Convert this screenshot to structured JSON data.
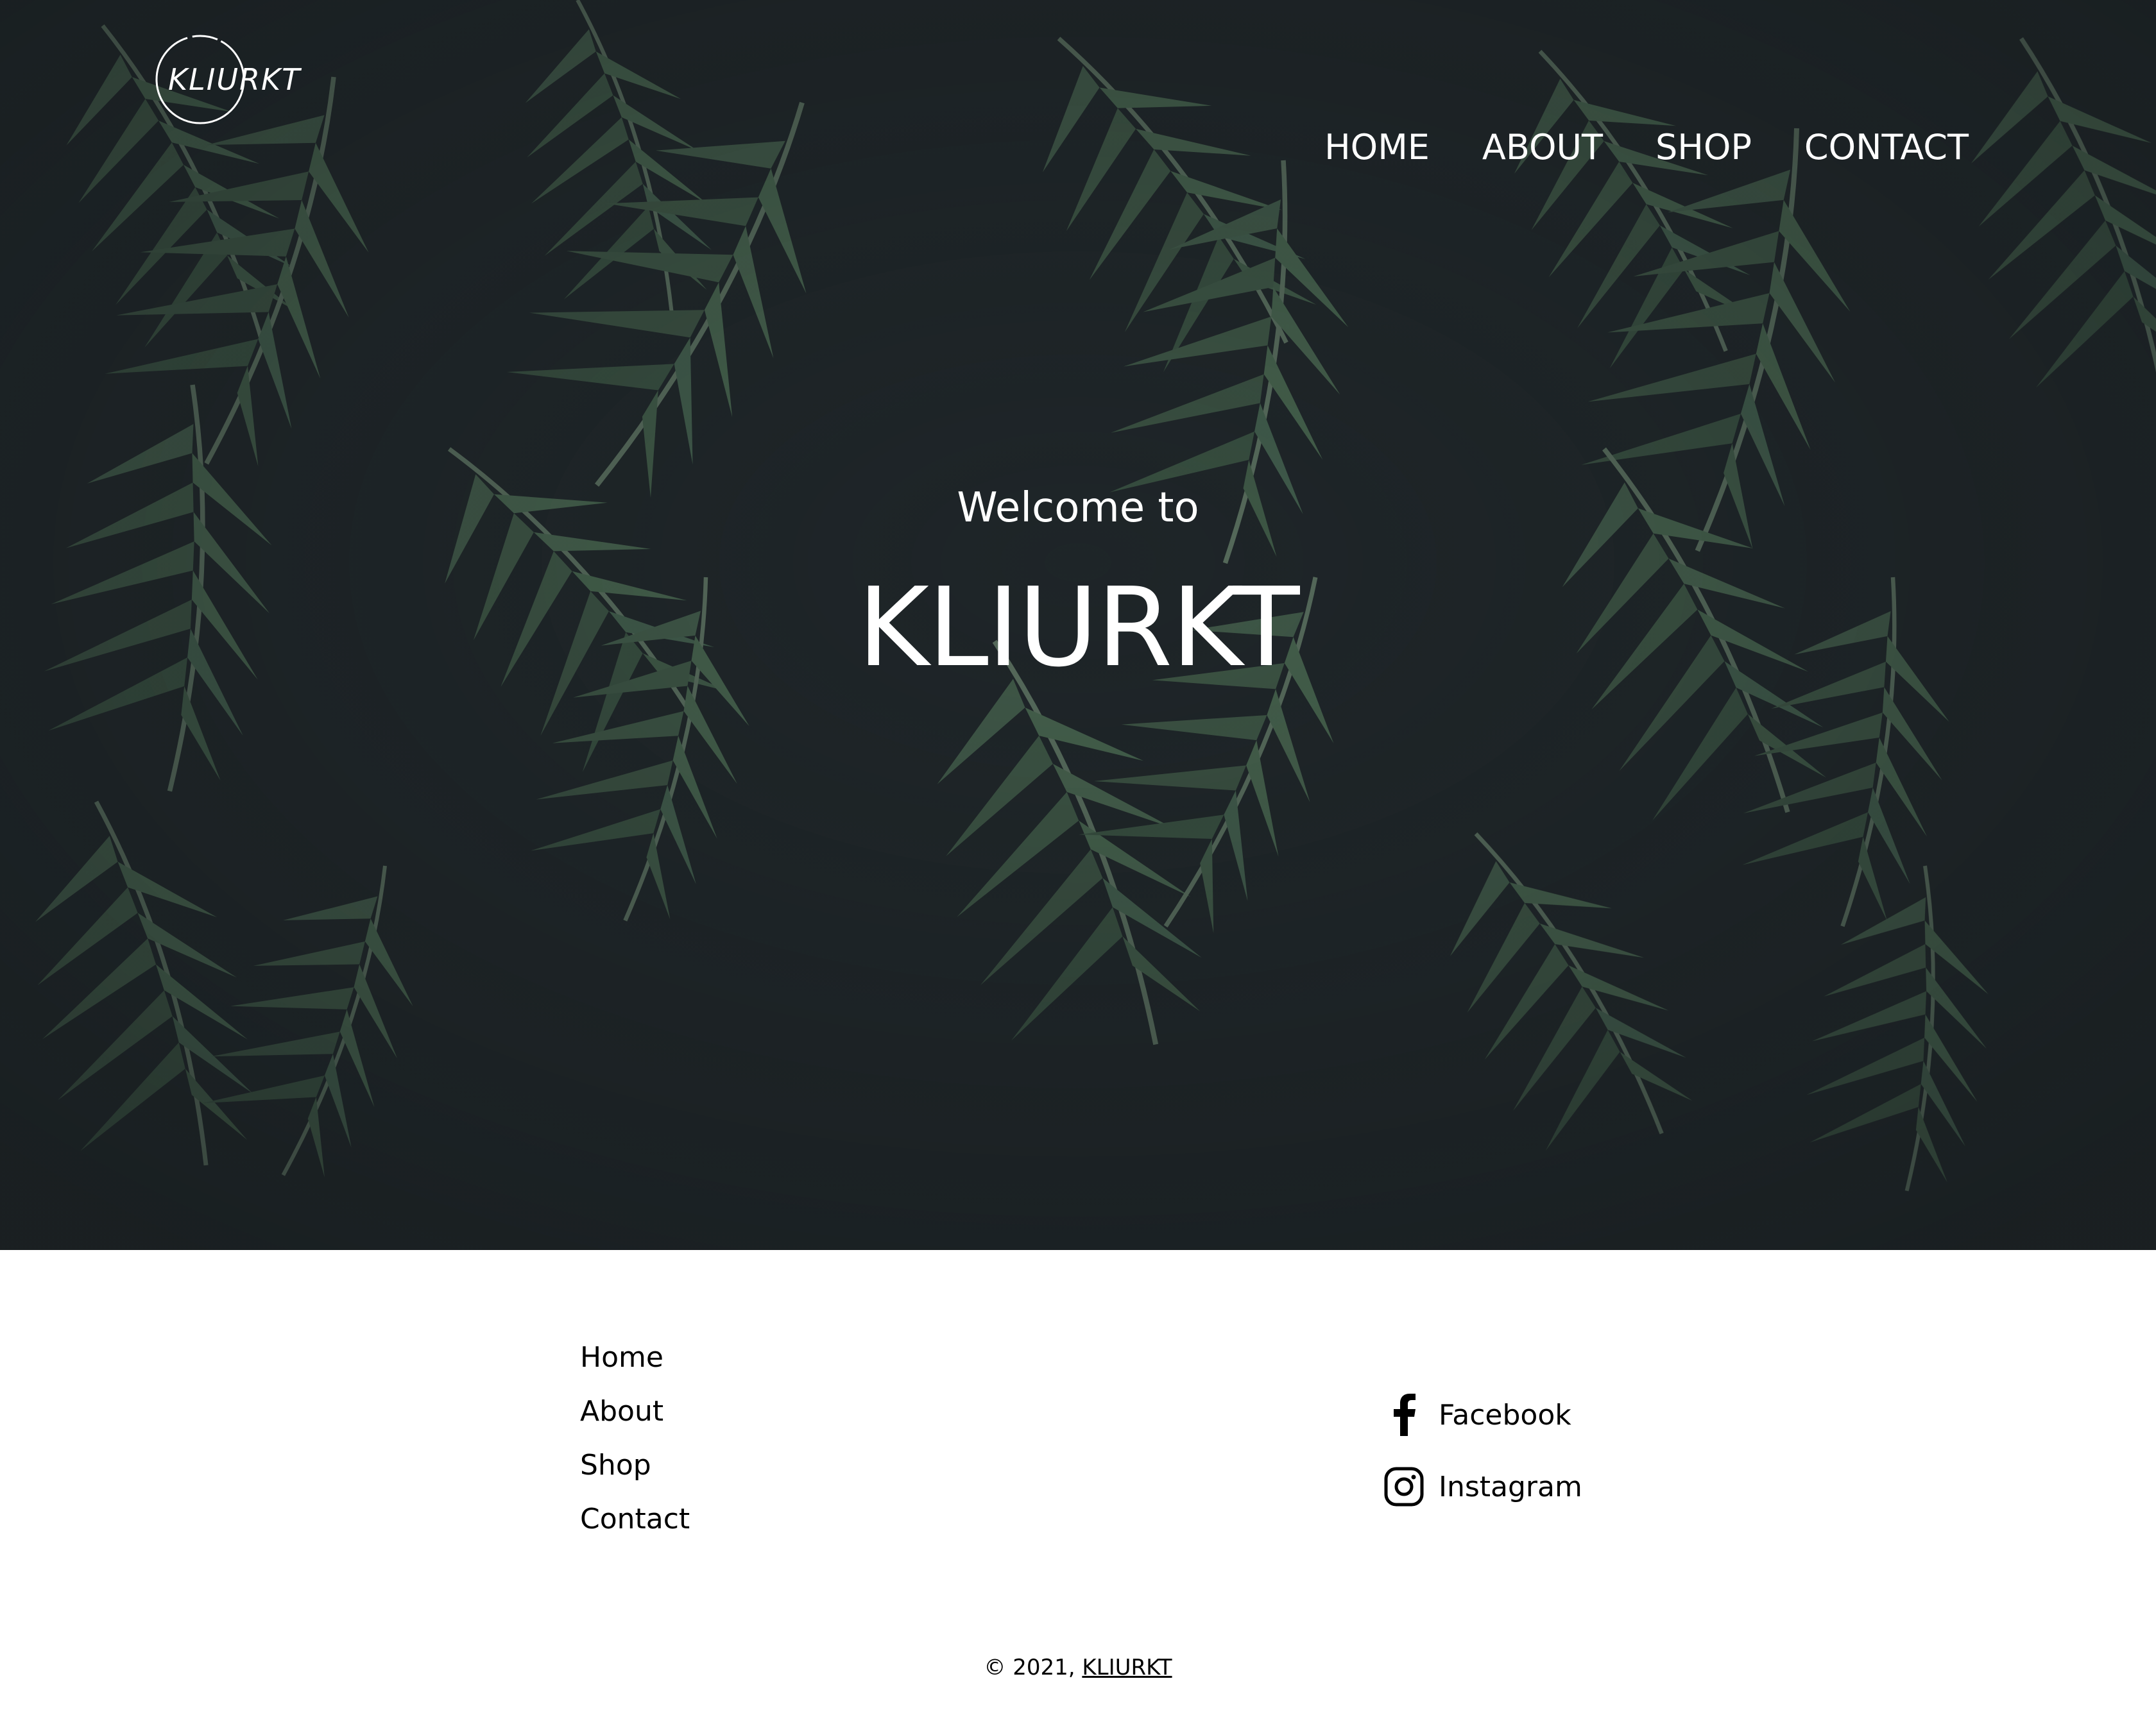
{
  "header": {
    "logo_text": "KLIURKT",
    "nav": [
      {
        "label": "HOME"
      },
      {
        "label": "ABOUT"
      },
      {
        "label": "SHOP"
      },
      {
        "label": "CONTACT"
      }
    ]
  },
  "hero": {
    "welcome": "Welcome to",
    "brand": "KLIURKT"
  },
  "footer": {
    "links": [
      {
        "label": "Home"
      },
      {
        "label": "About"
      },
      {
        "label": "Shop"
      },
      {
        "label": "Contact"
      }
    ],
    "social": [
      {
        "label": "Facebook",
        "icon": "facebook-icon"
      },
      {
        "label": "Instagram",
        "icon": "instagram-icon"
      }
    ],
    "copyright_prefix": "© 2021,",
    "copyright_link": "KLIURKT"
  },
  "colors": {
    "hero_bg": "#1e2427",
    "leaf": "#3f5a45",
    "text_light": "#ffffff",
    "text_dark": "#000000"
  }
}
